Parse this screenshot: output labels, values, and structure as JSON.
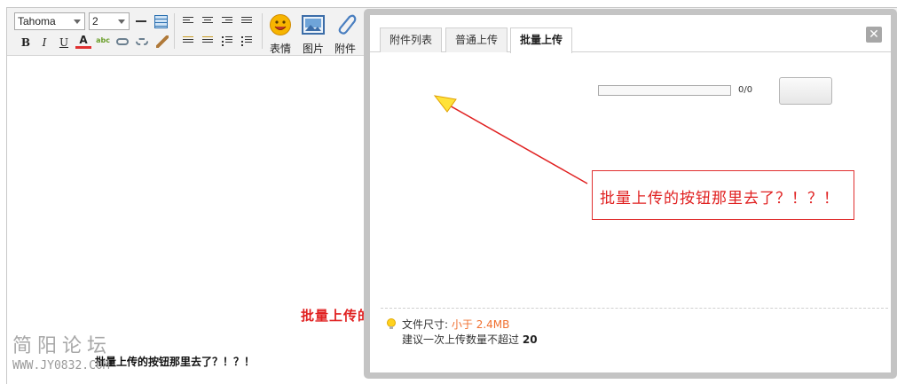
{
  "toolbar": {
    "font_family": "Tahoma",
    "font_size": "2",
    "emoji_label": "表情",
    "image_label": "图片",
    "attach_label": "附件",
    "bold_glyph": "B",
    "italic_glyph": "I",
    "underline_glyph": "U",
    "color_glyph": "A",
    "spell_glyph": "abc"
  },
  "content": {
    "small_text": "批量上传的按钮那里去了？！？！",
    "red_text": "批量上传的按钮那里去了？！？！"
  },
  "watermark": {
    "title": "简阳论坛",
    "url": "WWW.JY0832.COM"
  },
  "dialog": {
    "tabs": [
      {
        "label": "附件列表"
      },
      {
        "label": "普通上传"
      },
      {
        "label": "批量上传"
      }
    ],
    "active_tab": 2,
    "close_glyph": "✕",
    "progress": {
      "text": "0/0",
      "fraction": 0
    },
    "callout_text": "批量上传的按钮那里去了？！？！",
    "tip": {
      "size_label": "文件尺寸:",
      "size_value": "小于 2.4MB",
      "count_label": "建议一次上传数量不超过",
      "count_value": "20"
    }
  },
  "colors": {
    "annotation_red": "#e02020",
    "tip_accent": "#f07030",
    "dialog_border": "#c4c4c4"
  },
  "icons": [
    "chevron-down-icon",
    "table-icon",
    "align-left-icon",
    "align-center-icon",
    "align-right-icon",
    "ordered-list-icon",
    "unordered-list-icon",
    "emoji-icon",
    "image-icon",
    "paperclip-icon",
    "close-icon",
    "lightbulb-icon"
  ]
}
